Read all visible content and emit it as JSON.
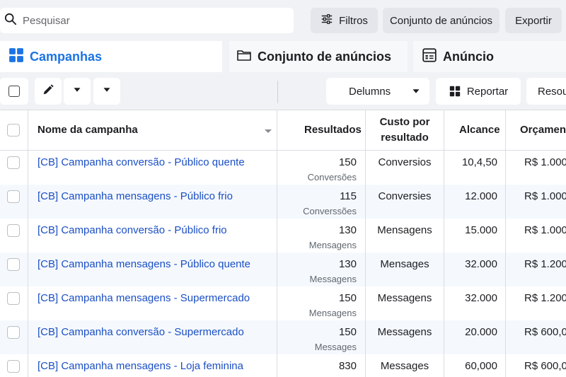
{
  "search": {
    "placeholder": "Pesquisar"
  },
  "top_buttons": {
    "filters": "Filtros",
    "adsets": "Conjunto de anúncios",
    "export": "Exportir"
  },
  "tabs": {
    "campaigns": "Campanhas",
    "adsets": "Conjunto de anúncios",
    "ads": "Anúncio"
  },
  "toolbar": {
    "columns": "Delumns",
    "report": "Reportar",
    "resources": "Resou"
  },
  "table": {
    "headers": {
      "name": "Nome da campanha",
      "results": "Resultados",
      "cost_line1": "Custo por",
      "cost_line2": "resultado",
      "reach": "Alcance",
      "budget": "Orçament"
    },
    "rows": [
      {
        "name": "[CB] Campanha conversão - Público quente",
        "results": "150",
        "result_type": "Conversões",
        "cost": "Conversios",
        "reach": "10,4,50",
        "budget": "R$ 1.000,"
      },
      {
        "name": "[CB] Campanha mensagens - Público frio",
        "results": "115",
        "result_type": "Converssões",
        "cost": "Conversies",
        "reach": "12.000",
        "budget": "R$ 1.000,"
      },
      {
        "name": "[CB] Campanha conversão - Público frio",
        "results": "130",
        "result_type": "Mensagens",
        "cost": "Mensagens",
        "reach": "15.000",
        "budget": "R$ 1.000,"
      },
      {
        "name": "[CB] Campanha mensagens - Público quente",
        "results": "130",
        "result_type": "Messagens",
        "cost": "Mensages",
        "reach": "32.000",
        "budget": "R$ 1.200,"
      },
      {
        "name": "[CB] Campanha mensagens - Supermercado",
        "results": "150",
        "result_type": "Mensagens",
        "cost": "Messagens",
        "reach": "32.000",
        "budget": "R$ 1.200,"
      },
      {
        "name": "[CB] Campanha conversão - Supermercado",
        "results": "150",
        "result_type": "Messages",
        "cost": "Messagens",
        "reach": "20.000",
        "budget": "R$ 600,0"
      },
      {
        "name": "[CB] Campanha mensagens - Loja feminina",
        "results": "830",
        "result_type": "",
        "cost": "Messages",
        "reach": "60,000",
        "budget": "R$ 600,0"
      }
    ]
  },
  "colors": {
    "accent": "#1b74e4",
    "link": "#1b4fc4",
    "row_alt": "#f5f9fd"
  }
}
